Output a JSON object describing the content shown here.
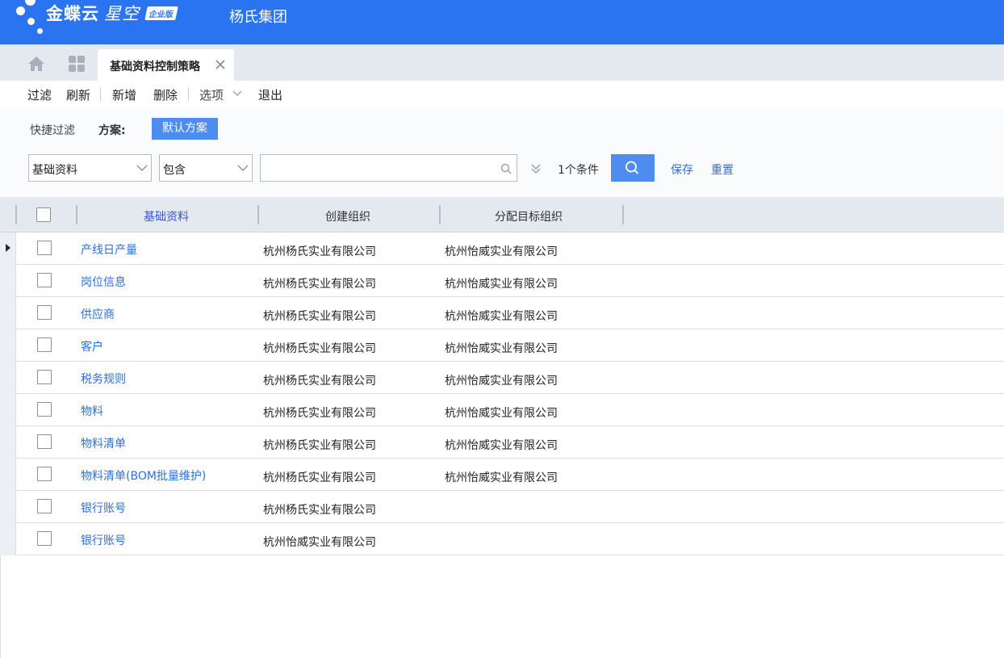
{
  "header": {
    "brand_name": "金蝶云",
    "brand_sub": "星空",
    "brand_edition": "企业版",
    "company": "杨氏集团",
    "bg_color": "#2a74f1"
  },
  "tabs": {
    "home_icon": "home-icon",
    "apps_icon": "grid-icon",
    "active_label": "基础资料控制策略"
  },
  "toolbar": {
    "filter_label": "过滤",
    "refresh_label": "刷新",
    "new_label": "新增",
    "delete_label": "删除",
    "options_label": "选项",
    "exit_label": "退出"
  },
  "filter": {
    "quick_filter_label": "快捷过滤",
    "scheme_label": "方案:",
    "default_scheme": "默认方案",
    "field_select": "基础资料",
    "operator_select": "包含",
    "search_value": "",
    "condition_count": "1个条件",
    "save_label": "保存",
    "reset_label": "重置",
    "accent_color": "#4e8cf0"
  },
  "grid": {
    "columns": [
      "基础资料",
      "创建组织",
      "分配目标组织"
    ],
    "rows": [
      {
        "item": "产线日产量",
        "creator": "杭州杨氏实业有限公司",
        "target": "杭州怡威实业有限公司",
        "current": true
      },
      {
        "item": "岗位信息",
        "creator": "杭州杨氏实业有限公司",
        "target": "杭州怡威实业有限公司"
      },
      {
        "item": "供应商",
        "creator": "杭州杨氏实业有限公司",
        "target": "杭州怡威实业有限公司"
      },
      {
        "item": "客户",
        "creator": "杭州杨氏实业有限公司",
        "target": "杭州怡威实业有限公司"
      },
      {
        "item": "税务规则",
        "creator": "杭州杨氏实业有限公司",
        "target": "杭州怡威实业有限公司"
      },
      {
        "item": "物料",
        "creator": "杭州杨氏实业有限公司",
        "target": "杭州怡威实业有限公司"
      },
      {
        "item": "物料清单",
        "creator": "杭州杨氏实业有限公司",
        "target": "杭州怡威实业有限公司"
      },
      {
        "item": "物料清单(BOM批量维护)",
        "creator": "杭州杨氏实业有限公司",
        "target": "杭州怡威实业有限公司"
      },
      {
        "item": "银行账号",
        "creator": "杭州杨氏实业有限公司",
        "target": ""
      },
      {
        "item": "银行账号",
        "creator": "杭州怡威实业有限公司",
        "target": ""
      }
    ],
    "link_color": "#2a6fe0"
  }
}
